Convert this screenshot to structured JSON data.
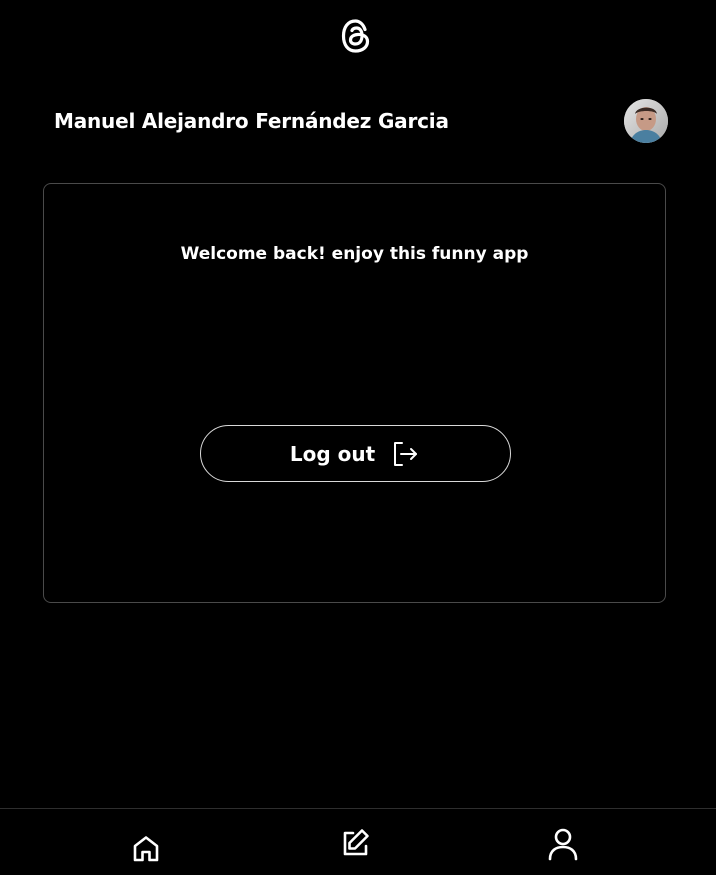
{
  "app": {
    "logo_icon": "threads-logo-icon"
  },
  "header": {
    "user_name": "Manuel Alejandro Fernández Garcia",
    "avatar_icon": "avatar"
  },
  "card": {
    "welcome_text": "Welcome back! enjoy this funny app",
    "logout_label": "Log out",
    "logout_icon": "logout-icon"
  },
  "bottom_nav": {
    "items": [
      {
        "icon": "home-icon"
      },
      {
        "icon": "edit-icon"
      },
      {
        "icon": "profile-icon"
      }
    ]
  },
  "colors": {
    "background": "#000000",
    "text": "#ffffff",
    "card_border": "#4a4a4a",
    "button_border": "#d9d9d9"
  }
}
